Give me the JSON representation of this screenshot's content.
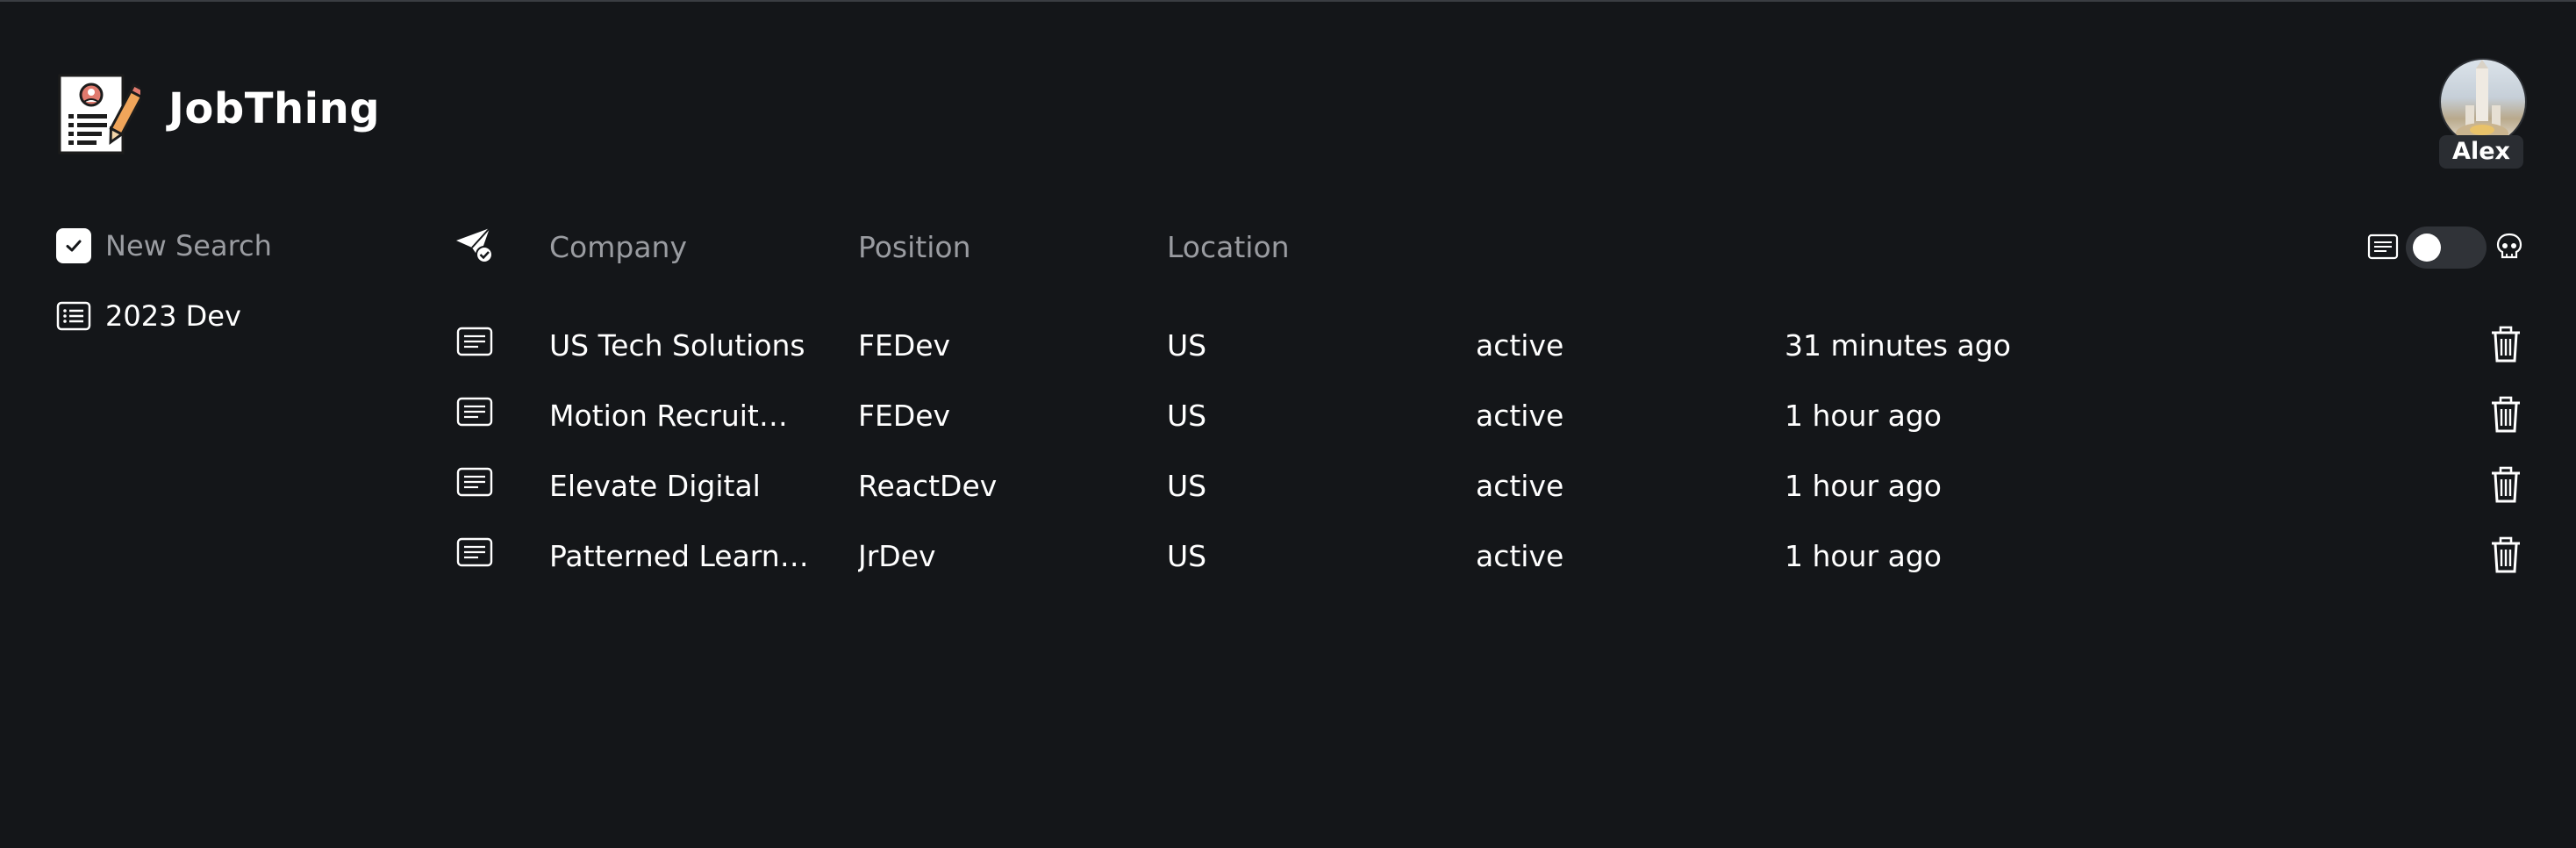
{
  "app": {
    "name": "JobThing"
  },
  "user": {
    "name": "Alex"
  },
  "sidebar": {
    "new_search_label": "New Search",
    "items": [
      {
        "label": "2023 Dev"
      }
    ]
  },
  "table": {
    "headers": {
      "company": "Company",
      "position": "Position",
      "location": "Location"
    },
    "rows": [
      {
        "company": "US Tech Solutions",
        "position": "FEDev",
        "location": "US",
        "status": "active",
        "updated": "31 minutes ago"
      },
      {
        "company": "Motion Recruitm...",
        "position": "FEDev",
        "location": "US",
        "status": "active",
        "updated": "1 hour ago"
      },
      {
        "company": "Elevate Digital",
        "position": "ReactDev",
        "location": "US",
        "status": "active",
        "updated": "1 hour ago"
      },
      {
        "company": "Patterned Learni...",
        "position": "JrDev",
        "location": "US",
        "status": "active",
        "updated": "1 hour ago"
      }
    ]
  },
  "icons": {
    "logo": "resume-pencil-icon",
    "new_search": "checkbox-icon",
    "list": "list-icon",
    "header": "paper-plane-check-icon",
    "row": "document-icon",
    "delete": "trash-icon",
    "toggle_left": "document-icon",
    "toggle_right": "skull-icon"
  },
  "colors": {
    "background": "#141619",
    "muted_text": "#9a9ca1",
    "text": "#ffffff",
    "toggle_track": "#303338"
  }
}
